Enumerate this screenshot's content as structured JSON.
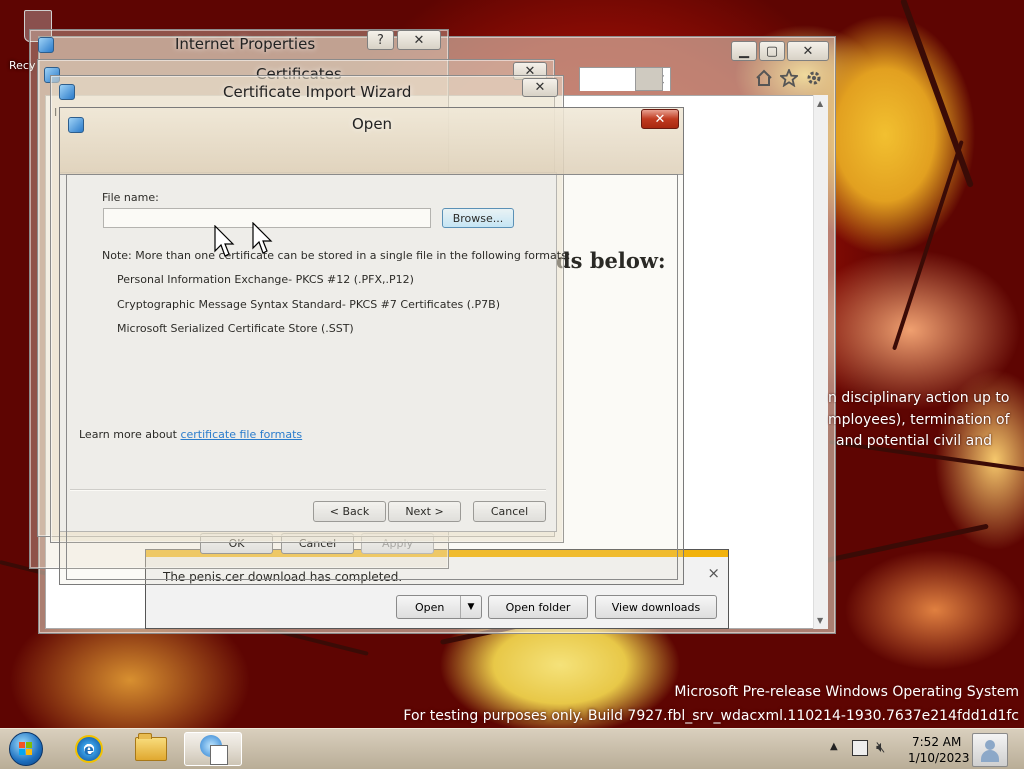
{
  "desktop": {
    "recycle_label": "Recy",
    "watermark_line1": "Microsoft Pre-release Windows Operating System",
    "watermark_line2": "For testing purposes only. Build 7927.fbl_srv_wdacxml.110214-1930.7637e214fdd1d1fc"
  },
  "ie": {
    "heading_fragment": "ds below:",
    "notice_line1": "n disciplinary action up to",
    "notice_line2": "mployees), termination of",
    "notice_line3": "and potential civil and",
    "download_message": "The penis.cer download has completed.",
    "open_label": "Open",
    "open_folder_label": "Open folder",
    "view_downloads_label": "View downloads",
    "tab_close": "×",
    "bar_close": "×"
  },
  "internet_properties": {
    "title": "Internet Properties",
    "help": "?",
    "ok_label": "OK",
    "cancel_label": "Cancel",
    "apply_label": "Apply"
  },
  "certificates": {
    "title": "Certificates",
    "tab_fragment": "I"
  },
  "wizard": {
    "title": "Certificate Import Wizard",
    "file_name_label": "File name:",
    "file_name_value": "",
    "browse_label": "Browse...",
    "note": "Note:  More than one certificate can be stored in a single file in the following formats:",
    "formats": [
      "Personal Information Exchange- PKCS #12 (.PFX,.P12)",
      "Cryptographic Message Syntax Standard- PKCS #7 Certificates (.P7B)",
      "Microsoft Serialized Certificate Store (.SST)"
    ],
    "learn_more_text": "Learn more about ",
    "learn_more_link": "certificate file formats",
    "back_label": "< Back",
    "next_label": "Next >",
    "cancel_label": "Cancel"
  },
  "open_dialog": {
    "title": "Open"
  },
  "taskbar": {
    "time": "7:52 AM",
    "date": "1/10/2023"
  },
  "colors": {
    "link": "#0066cc",
    "ie_download_accent": "#f2b20c",
    "close_red": "#c03a20"
  },
  "icons": [
    "start-orb-icon",
    "internet-explorer-icon",
    "folder-icon",
    "certificate-manager-icon",
    "network-icon",
    "volume-muted-icon",
    "flag-icon",
    "user-icon",
    "home-icon",
    "star-icon",
    "gear-icon"
  ]
}
